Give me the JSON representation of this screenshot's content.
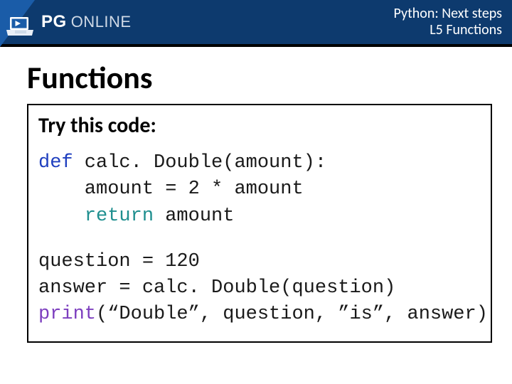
{
  "header": {
    "brand_pg": "PG",
    "brand_online": "ONLINE",
    "line1": "Python: Next steps",
    "line2": "L5 Functions"
  },
  "title": "Functions",
  "try_label": "Try this code:",
  "code": {
    "l1a": "def",
    "l1b": " calc. Double(amount):",
    "l2": "    amount = 2 * amount",
    "l3a": "    ",
    "l3b": "return",
    "l3c": " amount",
    "l4": "question = 120",
    "l5": "answer = calc. Double(question)",
    "l6a": "print",
    "l6b": "(“Double”, question, ”is”, answer)"
  }
}
